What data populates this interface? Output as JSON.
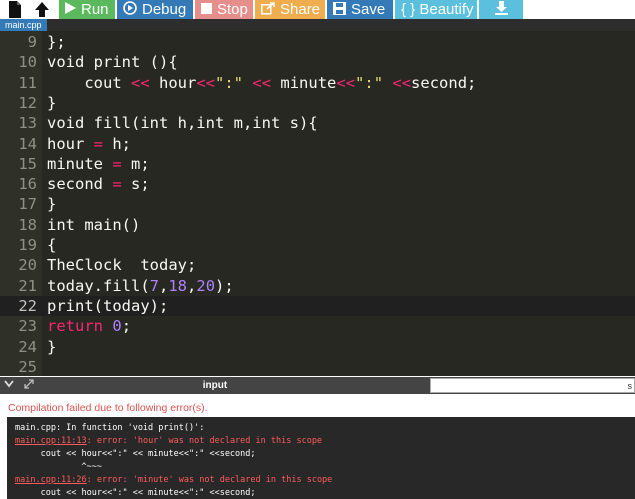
{
  "toolbar": {
    "buttons": {
      "run": "Run",
      "debug": "Debug",
      "stop": "Stop",
      "share": "Share",
      "save": "Save",
      "beautify": "{ } Beautify"
    },
    "icons": [
      "file-icon",
      "upload-icon",
      "play-icon",
      "debug-icon",
      "stop-icon",
      "share-icon",
      "save-icon",
      "download-icon"
    ]
  },
  "file_tab": {
    "name": "main.cpp"
  },
  "editor": {
    "active_line": 22,
    "lines": [
      {
        "n": "9",
        "tokens": [
          {
            "t": "};",
            "c": ""
          }
        ]
      },
      {
        "n": "10",
        "tokens": [
          {
            "t": "void print (){",
            "c": ""
          }
        ]
      },
      {
        "n": "11",
        "tokens": [
          {
            "t": "    cout ",
            "c": ""
          },
          {
            "t": "<<",
            "c": "op"
          },
          {
            "t": " hour",
            "c": ""
          },
          {
            "t": "<<",
            "c": "op"
          },
          {
            "t": "\":\"",
            "c": "str"
          },
          {
            "t": " ",
            "c": ""
          },
          {
            "t": "<<",
            "c": "op"
          },
          {
            "t": " minute",
            "c": ""
          },
          {
            "t": "<<",
            "c": "op"
          },
          {
            "t": "\":\"",
            "c": "str"
          },
          {
            "t": " ",
            "c": ""
          },
          {
            "t": "<<",
            "c": "op"
          },
          {
            "t": "second;",
            "c": ""
          }
        ]
      },
      {
        "n": "12",
        "tokens": [
          {
            "t": "}",
            "c": ""
          }
        ]
      },
      {
        "n": "13",
        "tokens": [
          {
            "t": "void fill(int h,int m,int s){",
            "c": ""
          }
        ]
      },
      {
        "n": "14",
        "tokens": [
          {
            "t": "hour ",
            "c": ""
          },
          {
            "t": "=",
            "c": "op"
          },
          {
            "t": " h;",
            "c": ""
          }
        ]
      },
      {
        "n": "15",
        "tokens": [
          {
            "t": "minute ",
            "c": ""
          },
          {
            "t": "=",
            "c": "op"
          },
          {
            "t": " m;",
            "c": ""
          }
        ]
      },
      {
        "n": "16",
        "tokens": [
          {
            "t": "second ",
            "c": ""
          },
          {
            "t": "=",
            "c": "op"
          },
          {
            "t": " s;",
            "c": ""
          }
        ]
      },
      {
        "n": "17",
        "tokens": [
          {
            "t": "}",
            "c": ""
          }
        ]
      },
      {
        "n": "18",
        "tokens": [
          {
            "t": "int main()",
            "c": ""
          }
        ]
      },
      {
        "n": "19",
        "tokens": [
          {
            "t": "{",
            "c": ""
          }
        ]
      },
      {
        "n": "20",
        "tokens": [
          {
            "t": "TheClock  today;",
            "c": ""
          }
        ]
      },
      {
        "n": "21",
        "tokens": [
          {
            "t": "today.fill(",
            "c": ""
          },
          {
            "t": "7",
            "c": "num"
          },
          {
            "t": ",",
            "c": ""
          },
          {
            "t": "18",
            "c": "num"
          },
          {
            "t": ",",
            "c": ""
          },
          {
            "t": "20",
            "c": "num"
          },
          {
            "t": ");",
            "c": ""
          }
        ]
      },
      {
        "n": "22",
        "tokens": [
          {
            "t": "print(today);",
            "c": ""
          }
        ]
      },
      {
        "n": "23",
        "tokens": [
          {
            "t": "return",
            "c": "kw"
          },
          {
            "t": " ",
            "c": ""
          },
          {
            "t": "0",
            "c": "num"
          },
          {
            "t": ";",
            "c": ""
          }
        ]
      },
      {
        "n": "24",
        "tokens": [
          {
            "t": "}",
            "c": ""
          }
        ]
      },
      {
        "n": "25",
        "tokens": []
      }
    ]
  },
  "panel": {
    "label": "input",
    "input_value": "s",
    "controls": [
      "chevron-down-icon",
      "expand-icon"
    ]
  },
  "output": {
    "compile_message": "Compilation failed due to following error(s).",
    "console_lines": [
      {
        "parts": [
          {
            "t": "main.cpp: In function 'void print()':",
            "c": ""
          }
        ]
      },
      {
        "parts": [
          {
            "t": "main.cpp:11:13",
            "c": "err link"
          },
          {
            "t": ": error: 'hour' was not declared in this scope",
            "c": "err"
          }
        ]
      },
      {
        "parts": [
          {
            "t": "     cout << hour<<\":\" << minute<<\":\" <<second;",
            "c": ""
          }
        ]
      },
      {
        "parts": [
          {
            "t": "             ^~~~",
            "c": ""
          }
        ]
      },
      {
        "parts": [
          {
            "t": "main.cpp:11:26",
            "c": "err link"
          },
          {
            "t": ": error: 'minute' was not declared in this scope",
            "c": "err"
          }
        ]
      },
      {
        "parts": [
          {
            "t": "     cout << hour<<\":\" << minute<<\":\" <<second;",
            "c": ""
          }
        ]
      }
    ]
  },
  "colors": {
    "run": "#5cb85c",
    "debug": "#337ab7",
    "stop": "#d9534f",
    "share": "#f0ad4e",
    "beautify": "#5bc0de",
    "editor_bg": "#272822",
    "error_text": "#d9534f"
  }
}
